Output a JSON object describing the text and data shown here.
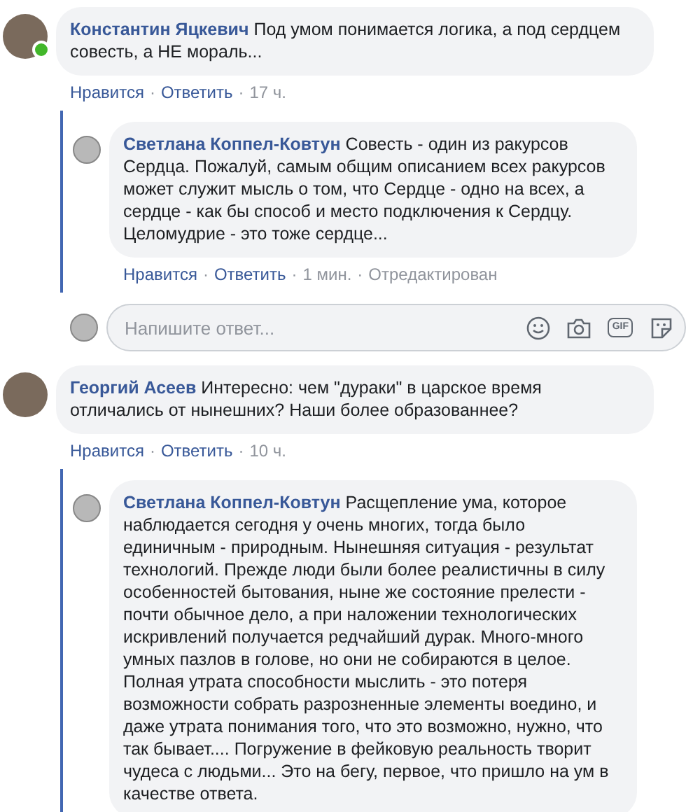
{
  "separator": "·",
  "comments": [
    {
      "author": "Константин Яцкевич",
      "text": "Под умом понимается логика, а под сердцем совесть, а НЕ мораль...",
      "online": true,
      "actions": [
        "Нравится",
        "Ответить"
      ],
      "time": "17 ч.",
      "replies": [
        {
          "author": "Светлана Коппел-Ковтун",
          "text": "Совесть - один из ракурсов Сердца. Пожалуй, самым общим описанием всех ракурсов может служит мысль о том, что Сердце - одно на всех, а сердце - как бы способ и место подключения к Сердцу. Целомудрие - это тоже сердце...",
          "actions": [
            "Нравится",
            "Ответить"
          ],
          "time": "1 мин.",
          "edited": "Отредактирован"
        }
      ],
      "reply_box": {
        "placeholder": "Напишите ответ...",
        "tools": [
          {
            "kind": "smiley"
          },
          {
            "kind": "camera"
          },
          {
            "kind": "gif",
            "label": "GIF"
          },
          {
            "kind": "sticker"
          }
        ]
      }
    },
    {
      "author": "Георгий Асеев",
      "text": "Интересно: чем \"дураки\" в царское время отличались от нынешних? Наши более образованнее?",
      "online": false,
      "actions": [
        "Нравится",
        "Ответить"
      ],
      "time": "10 ч.",
      "replies": [
        {
          "author": "Светлана Коппел-Ковтун",
          "text": "Расщепление ума, которое наблюдается сегодня у очень многих, тогда было единичным - природным. Нынешняя ситуация - результат технологий. Прежде люди были более реалистичны в силу особенностей бытования, ныне же состояние прелести - почти обычное дело, а при наложении технологических искривлений получается редчайший дурак. Много-много умных пазлов в голове, но они не собираются в целое. Полная утрата способности мыслить - это потеря возможности собрать разрозненные элементы воедино, и даже утрата понимания того, что это возможно, нужно, что так бывает.... Погружение в фейковую реальность творит чудеса с людьми... Это на бегу, первое, что пришло на ум в качестве ответа."
        }
      ]
    }
  ]
}
